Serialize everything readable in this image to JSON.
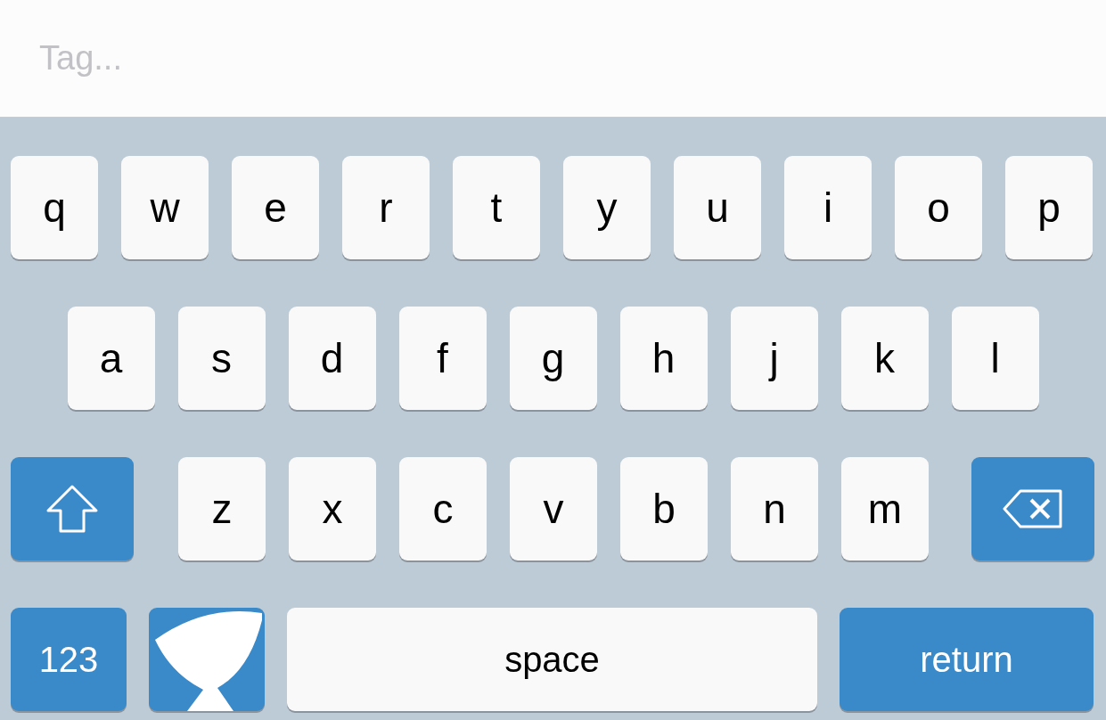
{
  "tag_field": {
    "placeholder": "Tag..."
  },
  "keyboard": {
    "rows": [
      {
        "keys": [
          {
            "kind": "letter",
            "label": "q"
          },
          {
            "kind": "letter",
            "label": "w"
          },
          {
            "kind": "letter",
            "label": "e"
          },
          {
            "kind": "letter",
            "label": "r"
          },
          {
            "kind": "letter",
            "label": "t"
          },
          {
            "kind": "letter",
            "label": "y"
          },
          {
            "kind": "letter",
            "label": "u"
          },
          {
            "kind": "letter",
            "label": "i"
          },
          {
            "kind": "letter",
            "label": "o"
          },
          {
            "kind": "letter",
            "label": "p"
          }
        ]
      },
      {
        "keys": [
          {
            "kind": "letter",
            "label": "a"
          },
          {
            "kind": "letter",
            "label": "s"
          },
          {
            "kind": "letter",
            "label": "d"
          },
          {
            "kind": "letter",
            "label": "f"
          },
          {
            "kind": "letter",
            "label": "g"
          },
          {
            "kind": "letter",
            "label": "h"
          },
          {
            "kind": "letter",
            "label": "j"
          },
          {
            "kind": "letter",
            "label": "k"
          },
          {
            "kind": "letter",
            "label": "l"
          }
        ]
      },
      {
        "keys": [
          {
            "kind": "shift"
          },
          {
            "kind": "letter",
            "label": "z"
          },
          {
            "kind": "letter",
            "label": "x"
          },
          {
            "kind": "letter",
            "label": "c"
          },
          {
            "kind": "letter",
            "label": "v"
          },
          {
            "kind": "letter",
            "label": "b"
          },
          {
            "kind": "letter",
            "label": "n"
          },
          {
            "kind": "letter",
            "label": "m"
          },
          {
            "kind": "delete"
          }
        ]
      },
      {
        "keys": [
          {
            "kind": "number",
            "label": "123"
          },
          {
            "kind": "logo"
          },
          {
            "kind": "space",
            "label": "space"
          },
          {
            "kind": "return",
            "label": "return"
          }
        ]
      }
    ]
  }
}
